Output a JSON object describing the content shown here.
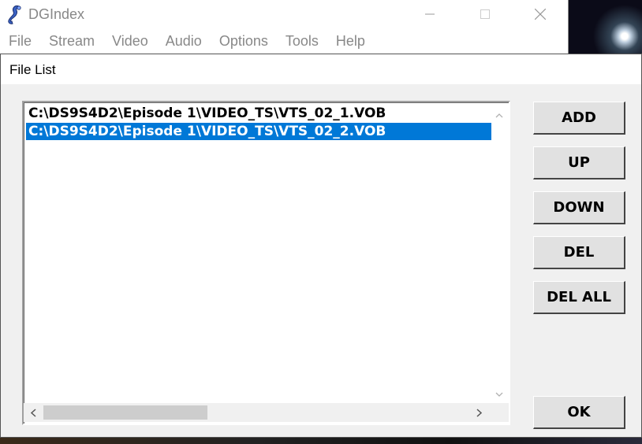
{
  "window": {
    "title": "DGIndex",
    "minimize_symbol": "—",
    "maximize_symbol": "☐",
    "close_symbol": "✕"
  },
  "menu": [
    "File",
    "Stream",
    "Video",
    "Audio",
    "Options",
    "Tools",
    "Help"
  ],
  "dialog": {
    "title": "File List",
    "files": [
      {
        "path": "C:\\DS9S4D2\\Episode 1\\VIDEO_TS\\VTS_02_1.VOB",
        "selected": false
      },
      {
        "path": "C:\\DS9S4D2\\Episode 1\\VIDEO_TS\\VTS_02_2.VOB",
        "selected": true
      }
    ],
    "buttons": {
      "add": "ADD",
      "up": "UP",
      "down": "DOWN",
      "del": "DEL",
      "del_all": "DEL ALL",
      "ok": "OK"
    }
  },
  "icons": {
    "vscroll_up": "chevron-up-icon",
    "vscroll_down": "chevron-down-icon",
    "hscroll_left": "chevron-left-icon",
    "hscroll_right": "chevron-right-icon"
  },
  "colors": {
    "selection": "#0078d7",
    "dialog_bg": "#f0f0f0"
  }
}
